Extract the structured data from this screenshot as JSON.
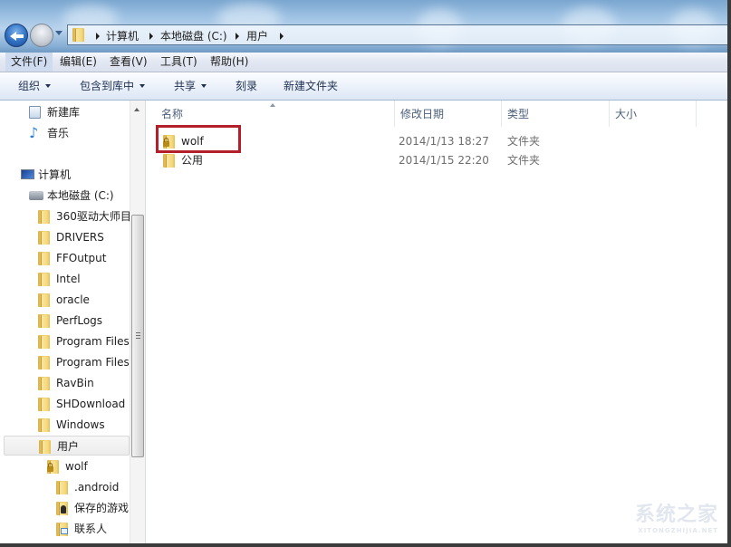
{
  "navigation": {
    "back_icon": "back-arrow-icon",
    "forward_icon": "forward-arrow-icon",
    "history_icon": "chevron-down-icon",
    "breadcrumb": [
      "计算机",
      "本地磁盘 (C:)",
      "用户"
    ]
  },
  "menubar": {
    "items": [
      "文件(F)",
      "编辑(E)",
      "查看(V)",
      "工具(T)",
      "帮助(H)"
    ],
    "active_index": 0
  },
  "toolbar": {
    "organize": "组织",
    "include_in_library": "包含到库中",
    "share": "共享",
    "burn": "刻录",
    "new_folder": "新建文件夹"
  },
  "navpane": {
    "items": [
      {
        "label": "新建库",
        "icon": "library-icon",
        "level": 1
      },
      {
        "label": "音乐",
        "icon": "music-icon",
        "level": 1
      },
      {
        "label": "计算机",
        "icon": "computer-icon",
        "level": 0
      },
      {
        "label": "本地磁盘 (C:)",
        "icon": "drive-icon",
        "level": 1
      },
      {
        "label": "360驱动大师目",
        "icon": "folder-icon",
        "level": 2
      },
      {
        "label": "DRIVERS",
        "icon": "folder-icon",
        "level": 2
      },
      {
        "label": "FFOutput",
        "icon": "folder-icon",
        "level": 2
      },
      {
        "label": "Intel",
        "icon": "folder-icon",
        "level": 2
      },
      {
        "label": "oracle",
        "icon": "folder-icon",
        "level": 2
      },
      {
        "label": "PerfLogs",
        "icon": "folder-icon",
        "level": 2
      },
      {
        "label": "Program Files",
        "icon": "folder-icon",
        "level": 2
      },
      {
        "label": "Program Files",
        "icon": "folder-icon",
        "level": 2
      },
      {
        "label": "RavBin",
        "icon": "folder-icon",
        "level": 2
      },
      {
        "label": "SHDownload",
        "icon": "folder-icon",
        "level": 2
      },
      {
        "label": "Windows",
        "icon": "folder-icon",
        "level": 2
      },
      {
        "label": "用户",
        "icon": "folder-icon",
        "level": 2,
        "selected": true
      },
      {
        "label": "wolf",
        "icon": "locked-folder-icon",
        "level": 3
      },
      {
        "label": ".android",
        "icon": "folder-icon",
        "level": 4
      },
      {
        "label": "保存的游戏",
        "icon": "saved-games-folder-icon",
        "level": 4
      },
      {
        "label": "联系人",
        "icon": "contacts-folder-icon",
        "level": 4
      }
    ]
  },
  "content": {
    "columns": [
      "名称",
      "修改日期",
      "类型",
      "大小"
    ],
    "rows": [
      {
        "name": "wolf",
        "modified": "2014/1/13 18:27",
        "type": "文件夹",
        "size": "",
        "icon": "locked-folder-icon",
        "highlighted": true
      },
      {
        "name": "公用",
        "modified": "2014/1/15 22:20",
        "type": "文件夹",
        "size": "",
        "icon": "folder-icon"
      }
    ]
  },
  "watermark": {
    "text": "系统之家",
    "subtext": "XITONGZHIJIA.NET"
  },
  "colors": {
    "highlight_box": "#b3202a",
    "aero": "#8db3d8"
  }
}
